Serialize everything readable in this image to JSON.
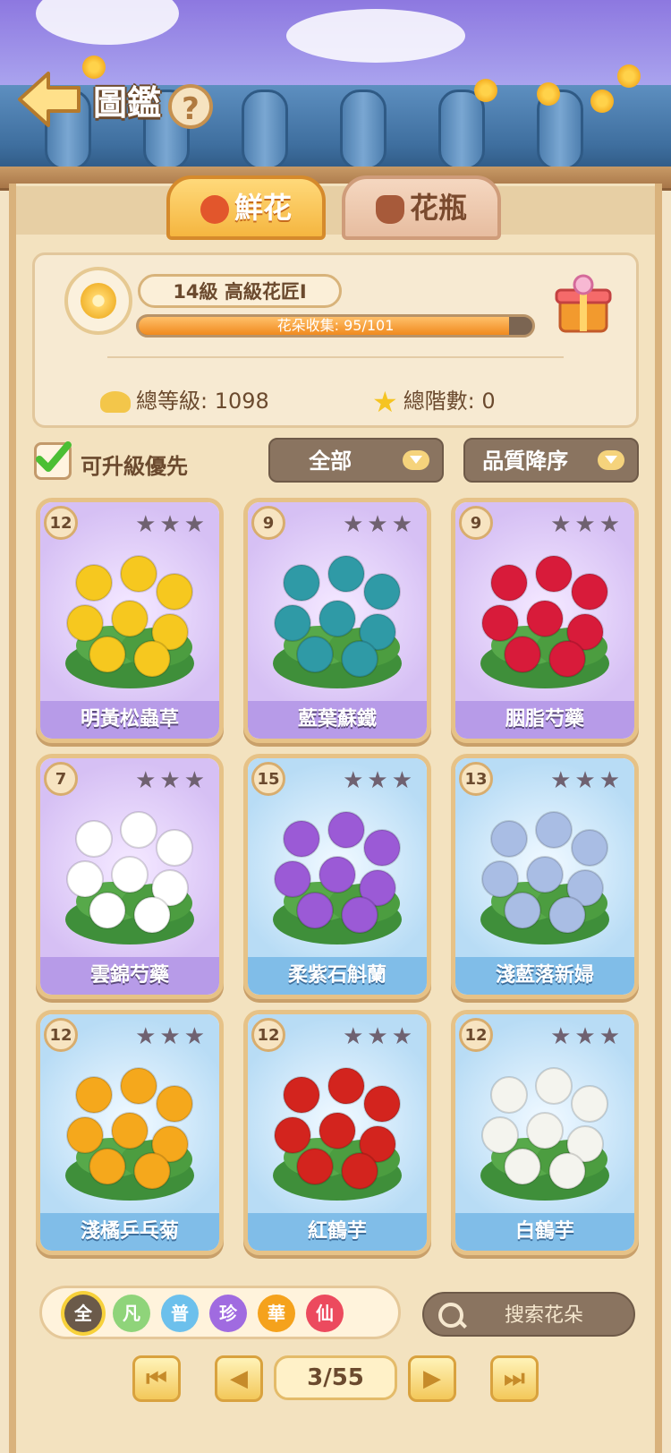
{
  "header": {
    "title": "圖鑑",
    "help_label": "?"
  },
  "tabs": [
    {
      "label": "鮮花",
      "icon": "rose-icon",
      "active": true
    },
    {
      "label": "花瓶",
      "icon": "vase-icon",
      "active": false
    }
  ],
  "profile": {
    "level_text": "14級  高級花匠Ⅰ",
    "collection_text": "花朵收集: 95/101",
    "collected": 95,
    "total": 101,
    "total_level_text": "總等級: 1098",
    "total_stage_text": "總階數: 0"
  },
  "filters": {
    "upgrade_first_label": "可升級優先",
    "upgrade_first_checked": true,
    "category_value": "全部",
    "sort_value": "品質降序"
  },
  "cards": [
    {
      "name": "明黃松蟲草",
      "level": "12",
      "stars": 3,
      "lit": 1,
      "theme": "purple",
      "color": "#f6c81f"
    },
    {
      "name": "藍葉蘇鐵",
      "level": "9",
      "stars": 3,
      "lit": 0,
      "theme": "purple",
      "color": "#2f9aa6"
    },
    {
      "name": "胭脂芍藥",
      "level": "9",
      "stars": 3,
      "lit": 0,
      "theme": "purple",
      "color": "#d81b3a"
    },
    {
      "name": "雲錦芍藥",
      "level": "7",
      "stars": 3,
      "lit": 0,
      "theme": "purple",
      "color": "#ffffff"
    },
    {
      "name": "柔紫石斛蘭",
      "level": "15",
      "stars": 3,
      "lit": 2,
      "theme": "blue",
      "color": "#9b5ad6"
    },
    {
      "name": "淺藍落新婦",
      "level": "13",
      "stars": 3,
      "lit": 2,
      "theme": "blue",
      "color": "#a9bde4"
    },
    {
      "name": "淺橘乒乓菊",
      "level": "12",
      "stars": 3,
      "lit": 1,
      "theme": "blue",
      "color": "#f5a81c"
    },
    {
      "name": "紅鶴芋",
      "level": "12",
      "stars": 3,
      "lit": 1,
      "theme": "blue",
      "color": "#d3241e"
    },
    {
      "name": "白鶴芋",
      "level": "12",
      "stars": 3,
      "lit": 1,
      "theme": "blue",
      "color": "#f4f4ee"
    }
  ],
  "rarity_filters": [
    {
      "label": "全",
      "color": "#6b5a4a"
    },
    {
      "label": "凡",
      "color": "#8fd47a"
    },
    {
      "label": "普",
      "color": "#6cc0ec"
    },
    {
      "label": "珍",
      "color": "#a06be0"
    },
    {
      "label": "華",
      "color": "#f5a21c"
    },
    {
      "label": "仙",
      "color": "#ec4a5e"
    }
  ],
  "search": {
    "placeholder": "搜索花朵"
  },
  "pagination": {
    "text": "3/55",
    "current": 3,
    "total": 55
  }
}
